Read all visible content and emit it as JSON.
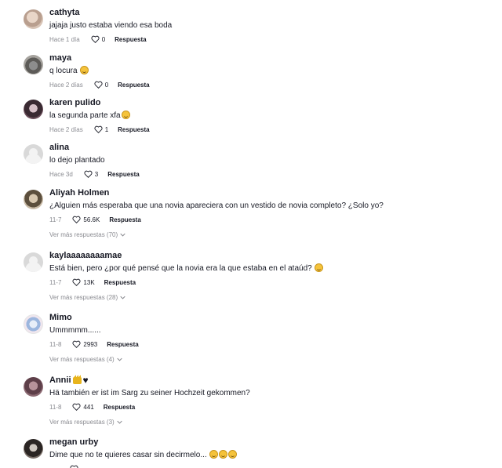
{
  "comments": [
    {
      "username": "cathyta",
      "text": "jajaja justo estaba viendo esa boda",
      "date": "Hace 1 día",
      "likes": "0",
      "reply_label": "Respuesta",
      "more_replies": null
    },
    {
      "username": "maya",
      "text": "q locura",
      "emoji": "slightly-smiling-face",
      "date": "Hace 2 días",
      "likes": "0",
      "reply_label": "Respuesta",
      "more_replies": null
    },
    {
      "username": "karen pulido",
      "text": "la segunda parte xfa",
      "emoji": "laughing-face",
      "date": "Hace 2 días",
      "likes": "1",
      "reply_label": "Respuesta",
      "more_replies": null
    },
    {
      "username": "alina",
      "text": "lo dejo plantado",
      "date": "Hace 3d",
      "likes": "3",
      "reply_label": "Respuesta",
      "more_replies": null
    },
    {
      "username": "Aliyah Holmen",
      "text": "¿Alguien más esperaba que una novia apareciera con un vestido de novia completo? ¿Solo yo?",
      "date": "11-7",
      "likes": "56.6K",
      "reply_label": "Respuesta",
      "more_replies": "Ver más respuestas (70)"
    },
    {
      "username": "kaylaaaaaaaamae",
      "text": "Está bien, pero ¿por qué pensé que la novia era la que estaba en el ataúd?",
      "emoji": "rolling-laughing-face",
      "date": "11-7",
      "likes": "13K",
      "reply_label": "Respuesta",
      "more_replies": "Ver más respuestas (28)"
    },
    {
      "username": "Mimo",
      "text": "Ummmmm......",
      "date": "11-8",
      "likes": "2993",
      "reply_label": "Respuesta",
      "more_replies": "Ver más respuestas (4)"
    },
    {
      "username": "Annii",
      "username_icons": [
        "crown",
        "black-heart"
      ],
      "text": "Hä también er ist im Sarg zu seiner Hochzeit gekommen?",
      "date": "11-8",
      "likes": "441",
      "reply_label": "Respuesta",
      "more_replies": "Ver más respuestas (3)"
    },
    {
      "username": "megan urby",
      "text": "Dime que no te quieres casar sin decirmelo...",
      "emoji": "laughing-face",
      "emoji_count": 3,
      "date": "",
      "likes": "",
      "reply_label": "",
      "more_replies": null
    }
  ],
  "colors": {
    "text": "#161823",
    "muted": "#8a8b91",
    "emoji": "#f5c33b"
  }
}
